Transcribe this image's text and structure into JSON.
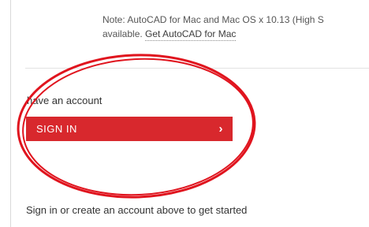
{
  "note": {
    "line1": "Note: AutoCAD for Mac and Mac OS x 10.13 (High S",
    "line2_prefix": "available. ",
    "link_label": "Get AutoCAD for Mac"
  },
  "account": {
    "prompt": "have an account",
    "signin_label": "SIGN IN",
    "chevron_glyph": "›"
  },
  "footer": {
    "text": "Sign in or create an account above to get started"
  },
  "colors": {
    "signin_button": "#d8282d",
    "annotation_ellipse": "#e0141e"
  },
  "icons": {
    "signin_chevron": "chevron-right-icon"
  }
}
